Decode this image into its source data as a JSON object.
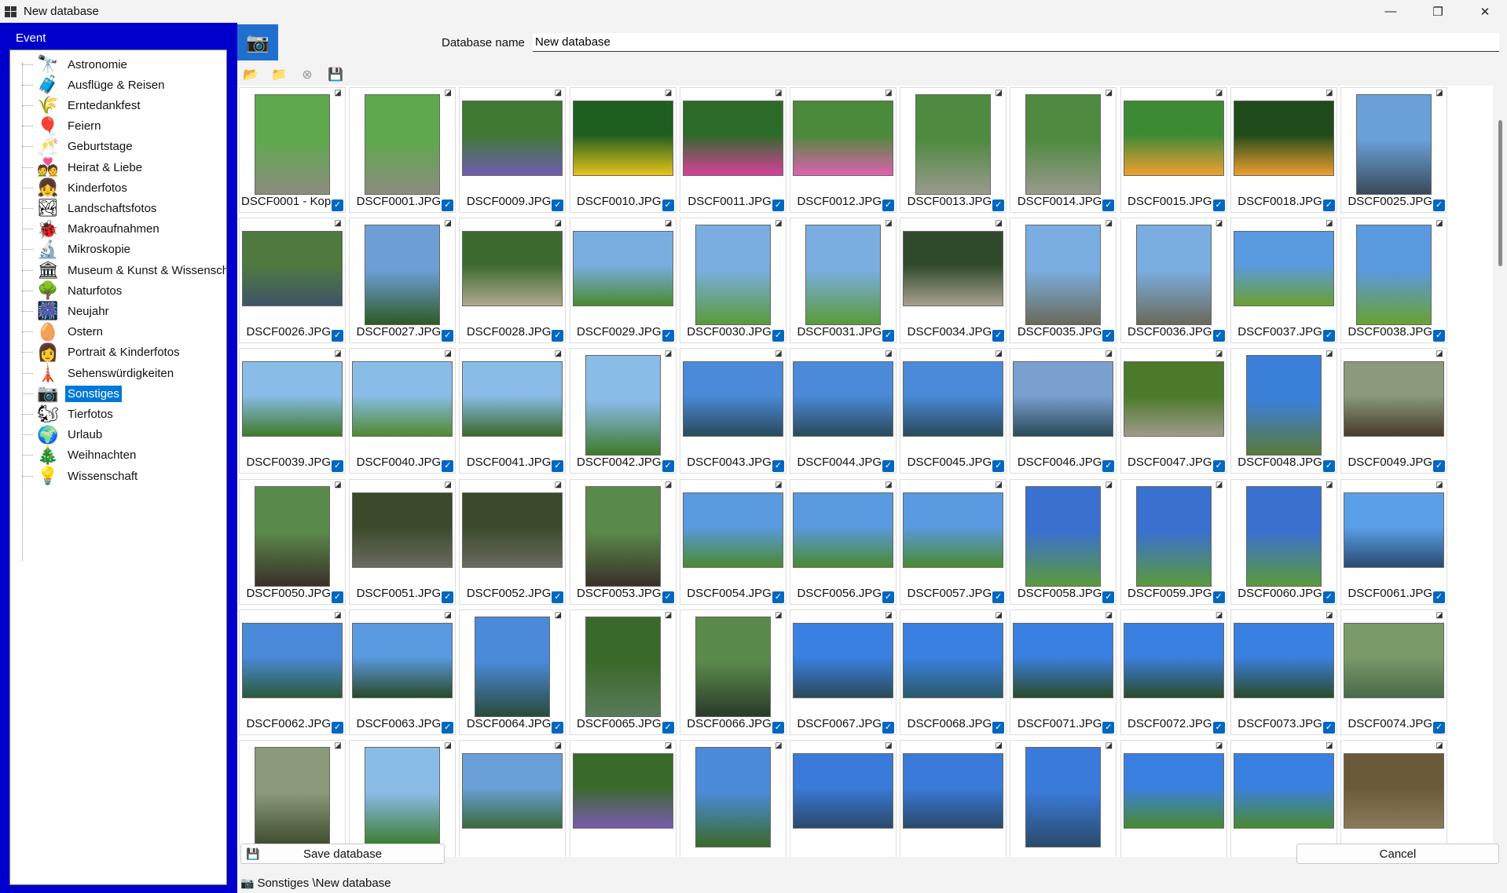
{
  "window": {
    "title": "New database",
    "minimize": "—",
    "maximize": "❐",
    "close": "✕"
  },
  "left": {
    "heading": "Event",
    "items": [
      {
        "label": "Astronomie",
        "icon": "🔭",
        "icon_name": "telescope-icon"
      },
      {
        "label": "Ausflüge & Reisen",
        "icon": "🧳",
        "icon_name": "luggage-icon"
      },
      {
        "label": "Erntedankfest",
        "icon": "🌾",
        "icon_name": "harvest-icon"
      },
      {
        "label": "Feiern",
        "icon": "🎈",
        "icon_name": "balloons-icon"
      },
      {
        "label": "Geburtstage",
        "icon": "🥂",
        "icon_name": "glasses-icon"
      },
      {
        "label": "Heirat & Liebe",
        "icon": "💑",
        "icon_name": "couple-icon"
      },
      {
        "label": "Kinderfotos",
        "icon": "👧",
        "icon_name": "child-icon"
      },
      {
        "label": "Landschaftsfotos",
        "icon": "🏞",
        "icon_name": "landscape-icon"
      },
      {
        "label": "Makroaufnahmen",
        "icon": "🐞",
        "icon_name": "ladybug-icon"
      },
      {
        "label": "Mikroskopie",
        "icon": "🔬",
        "icon_name": "microscope-icon"
      },
      {
        "label": "Museum & Kunst & Wissenschaft",
        "icon": "🏛",
        "icon_name": "museum-icon"
      },
      {
        "label": "Naturfotos",
        "icon": "🌳",
        "icon_name": "nature-icon"
      },
      {
        "label": "Neujahr",
        "icon": "🎆",
        "icon_name": "fireworks-icon"
      },
      {
        "label": "Ostern",
        "icon": "🥚",
        "icon_name": "easter-egg-icon"
      },
      {
        "label": "Portrait & Kinderfotos",
        "icon": "👩",
        "icon_name": "portrait-icon"
      },
      {
        "label": "Sehenswürdigkeiten",
        "icon": "🗼",
        "icon_name": "landmark-icon"
      },
      {
        "label": "Sonstiges",
        "icon": "📷",
        "icon_name": "camera-icon"
      },
      {
        "label": "Tierfotos",
        "icon": "🐿",
        "icon_name": "squirrel-icon"
      },
      {
        "label": "Urlaub",
        "icon": "🌍",
        "icon_name": "globe-icon"
      },
      {
        "label": "Weihnachten",
        "icon": "🎄",
        "icon_name": "christmas-icon"
      },
      {
        "label": "Wissenschaft",
        "icon": "💡",
        "icon_name": "lightbulb-icon"
      }
    ],
    "selected": "Sonstiges"
  },
  "header": {
    "dbname_label": "Database name",
    "dbname_value": "New database",
    "db_icon": "📷"
  },
  "toolbar": [
    {
      "name": "open-folder-button",
      "icon": "📂",
      "color": "#e8a317"
    },
    {
      "name": "add-folder-button",
      "icon": "📁",
      "color": "#e8a317"
    },
    {
      "name": "remove-button",
      "icon": "⊗",
      "color": "#9a9a9a"
    },
    {
      "name": "save-icon-button",
      "icon": "💾",
      "color": "#333333"
    }
  ],
  "photos": [
    {
      "name": "DSCF0001 - Kop",
      "o": "p",
      "c": [
        "#5fa84e",
        "#8c8c80"
      ]
    },
    {
      "name": "DSCF0001.JPG",
      "o": "p",
      "c": [
        "#5fa84e",
        "#8c8c80"
      ]
    },
    {
      "name": "DSCF0009.JPG",
      "o": "l",
      "c": [
        "#3f7a33",
        "#6f5bb0"
      ]
    },
    {
      "name": "DSCF0010.JPG",
      "o": "l",
      "c": [
        "#1e5e20",
        "#e8c31a"
      ]
    },
    {
      "name": "DSCF0011.JPG",
      "o": "l",
      "c": [
        "#2d6b2a",
        "#d8409a"
      ]
    },
    {
      "name": "DSCF0012.JPG",
      "o": "l",
      "c": [
        "#4a8a3a",
        "#e060b0"
      ]
    },
    {
      "name": "DSCF0013.JPG",
      "o": "p",
      "c": [
        "#4e8a3f",
        "#9a9a8f"
      ]
    },
    {
      "name": "DSCF0014.JPG",
      "o": "p",
      "c": [
        "#4e8a3f",
        "#9a9a8f"
      ]
    },
    {
      "name": "DSCF0015.JPG",
      "o": "l",
      "c": [
        "#3d8a35",
        "#f0a030"
      ]
    },
    {
      "name": "DSCF0018.JPG",
      "o": "l",
      "c": [
        "#1f4a1a",
        "#f0a030"
      ]
    },
    {
      "name": "DSCF0025.JPG",
      "o": "p",
      "c": [
        "#6aa0d8",
        "#3a4a5a"
      ]
    },
    {
      "name": "DSCF0026.JPG",
      "o": "l",
      "c": [
        "#4f7a3f",
        "#3e5566"
      ]
    },
    {
      "name": "DSCF0027.JPG",
      "o": "p",
      "c": [
        "#6d9fd6",
        "#2f5a25"
      ]
    },
    {
      "name": "DSCF0028.JPG",
      "o": "l",
      "c": [
        "#3d6b2f",
        "#b0a890"
      ]
    },
    {
      "name": "DSCF0029.JPG",
      "o": "l",
      "c": [
        "#7aaee0",
        "#4a8a30"
      ]
    },
    {
      "name": "DSCF0030.JPG",
      "o": "p",
      "c": [
        "#7aaee0",
        "#5a9a3a"
      ]
    },
    {
      "name": "DSCF0031.JPG",
      "o": "p",
      "c": [
        "#7aaee0",
        "#5a9a3a"
      ]
    },
    {
      "name": "DSCF0034.JPG",
      "o": "l",
      "c": [
        "#2f4a2a",
        "#a8a090"
      ]
    },
    {
      "name": "DSCF0035.JPG",
      "o": "p",
      "c": [
        "#7aaee0",
        "#6a6a5a"
      ]
    },
    {
      "name": "DSCF0036.JPG",
      "o": "p",
      "c": [
        "#7aaee0",
        "#6a6a5a"
      ]
    },
    {
      "name": "DSCF0037.JPG",
      "o": "l",
      "c": [
        "#5a9ae0",
        "#6aa030"
      ]
    },
    {
      "name": "DSCF0038.JPG",
      "o": "p",
      "c": [
        "#5a9ae0",
        "#6aa030"
      ]
    },
    {
      "name": "DSCF0039.JPG",
      "o": "l",
      "c": [
        "#8abce8",
        "#3f7a2a"
      ]
    },
    {
      "name": "DSCF0040.JPG",
      "o": "l",
      "c": [
        "#8abce8",
        "#4f8a30"
      ]
    },
    {
      "name": "DSCF0041.JPG",
      "o": "l",
      "c": [
        "#8abce8",
        "#3a6a2a"
      ]
    },
    {
      "name": "DSCF0042.JPG",
      "o": "p",
      "c": [
        "#8abce8",
        "#3f7a2a"
      ]
    },
    {
      "name": "DSCF0043.JPG",
      "o": "l",
      "c": [
        "#4a8ad8",
        "#2a4a5a"
      ]
    },
    {
      "name": "DSCF0044.JPG",
      "o": "l",
      "c": [
        "#4a8ad8",
        "#2a4a5a"
      ]
    },
    {
      "name": "DSCF0045.JPG",
      "o": "l",
      "c": [
        "#4a8ad8",
        "#2a4a5a"
      ]
    },
    {
      "name": "DSCF0046.JPG",
      "o": "l",
      "c": [
        "#7aa0d0",
        "#2a4a5a"
      ]
    },
    {
      "name": "DSCF0047.JPG",
      "o": "l",
      "c": [
        "#4a7a2a",
        "#a09a8a"
      ]
    },
    {
      "name": "DSCF0048.JPG",
      "o": "p",
      "c": [
        "#3a80d8",
        "#5a7a3a"
      ]
    },
    {
      "name": "DSCF0049.JPG",
      "o": "l",
      "c": [
        "#8a9a7a",
        "#4a3a2a"
      ]
    },
    {
      "name": "DSCF0050.JPG",
      "o": "p",
      "c": [
        "#5a8a4a",
        "#3a3028"
      ]
    },
    {
      "name": "DSCF0051.JPG",
      "o": "l",
      "c": [
        "#3a4a2a",
        "#6a6a60"
      ]
    },
    {
      "name": "DSCF0052.JPG",
      "o": "l",
      "c": [
        "#3a4a2a",
        "#6a6a60"
      ]
    },
    {
      "name": "DSCF0053.JPG",
      "o": "p",
      "c": [
        "#5a8a4a",
        "#3a3028"
      ]
    },
    {
      "name": "DSCF0054.JPG",
      "o": "l",
      "c": [
        "#5a9ae0",
        "#4a8a30"
      ]
    },
    {
      "name": "DSCF0056.JPG",
      "o": "l",
      "c": [
        "#5a9ae0",
        "#4a8a30"
      ]
    },
    {
      "name": "DSCF0057.JPG",
      "o": "l",
      "c": [
        "#5a9ae0",
        "#4a8a30"
      ]
    },
    {
      "name": "DSCF0058.JPG",
      "o": "p",
      "c": [
        "#3a70d0",
        "#5a9a3a"
      ]
    },
    {
      "name": "DSCF0059.JPG",
      "o": "p",
      "c": [
        "#3a70d0",
        "#5a9a3a"
      ]
    },
    {
      "name": "DSCF0060.JPG",
      "o": "p",
      "c": [
        "#3a70d0",
        "#5a9a3a"
      ]
    },
    {
      "name": "DSCF0061.JPG",
      "o": "l",
      "c": [
        "#5aa0e8",
        "#2a4a70"
      ]
    },
    {
      "name": "DSCF0062.JPG",
      "o": "l",
      "c": [
        "#4a8ad8",
        "#2a5a3a"
      ]
    },
    {
      "name": "DSCF0063.JPG",
      "o": "l",
      "c": [
        "#5a9ae0",
        "#2a4a2a"
      ]
    },
    {
      "name": "DSCF0064.JPG",
      "o": "p",
      "c": [
        "#4a8ad8",
        "#2a4a3a"
      ]
    },
    {
      "name": "DSCF0065.JPG",
      "o": "p",
      "c": [
        "#3a6a2a",
        "#5a7a5a"
      ]
    },
    {
      "name": "DSCF0066.JPG",
      "o": "p",
      "c": [
        "#5a8a4a",
        "#2a3a2a"
      ]
    },
    {
      "name": "DSCF0067.JPG",
      "o": "l",
      "c": [
        "#3a80e0",
        "#2a4a5a"
      ]
    },
    {
      "name": "DSCF0068.JPG",
      "o": "l",
      "c": [
        "#3a80e0",
        "#2a5a6a"
      ]
    },
    {
      "name": "DSCF0071.JPG",
      "o": "l",
      "c": [
        "#3a80e0",
        "#2a4a2a"
      ]
    },
    {
      "name": "DSCF0072.JPG",
      "o": "l",
      "c": [
        "#3a80e0",
        "#2a4a2a"
      ]
    },
    {
      "name": "DSCF0073.JPG",
      "o": "l",
      "c": [
        "#3a80e0",
        "#2a4a2a"
      ]
    },
    {
      "name": "DSCF0074.JPG",
      "o": "l",
      "c": [
        "#7a9a6a",
        "#4a6a4a"
      ]
    },
    {
      "name": "",
      "o": "p",
      "c": [
        "#8a9a7a",
        "#3a4a2a"
      ]
    },
    {
      "name": "",
      "o": "p",
      "c": [
        "#8abce8",
        "#3a7a2a"
      ]
    },
    {
      "name": "",
      "o": "l",
      "c": [
        "#6aa0d8",
        "#3a6a3a"
      ]
    },
    {
      "name": "",
      "o": "l",
      "c": [
        "#3a6a2a",
        "#7a5ab0"
      ]
    },
    {
      "name": "",
      "o": "p",
      "c": [
        "#4a8ad8",
        "#3a6a2a"
      ]
    },
    {
      "name": "",
      "o": "l",
      "c": [
        "#3a7ad8",
        "#2a4a6a"
      ]
    },
    {
      "name": "",
      "o": "l",
      "c": [
        "#3a7ad8",
        "#2a4a6a"
      ]
    },
    {
      "name": "",
      "o": "p",
      "c": [
        "#3a7ad8",
        "#2a4a6a"
      ]
    },
    {
      "name": "",
      "o": "l",
      "c": [
        "#3a80e0",
        "#4a8a30"
      ]
    },
    {
      "name": "",
      "o": "l",
      "c": [
        "#3a80e0",
        "#4a8a30"
      ]
    },
    {
      "name": "",
      "o": "l",
      "c": [
        "#6a5a3a",
        "#8a7a5a"
      ]
    }
  ],
  "footer": {
    "save_label": "Save database",
    "cancel_label": "Cancel",
    "status_text": "Sonstiges \\New database"
  }
}
